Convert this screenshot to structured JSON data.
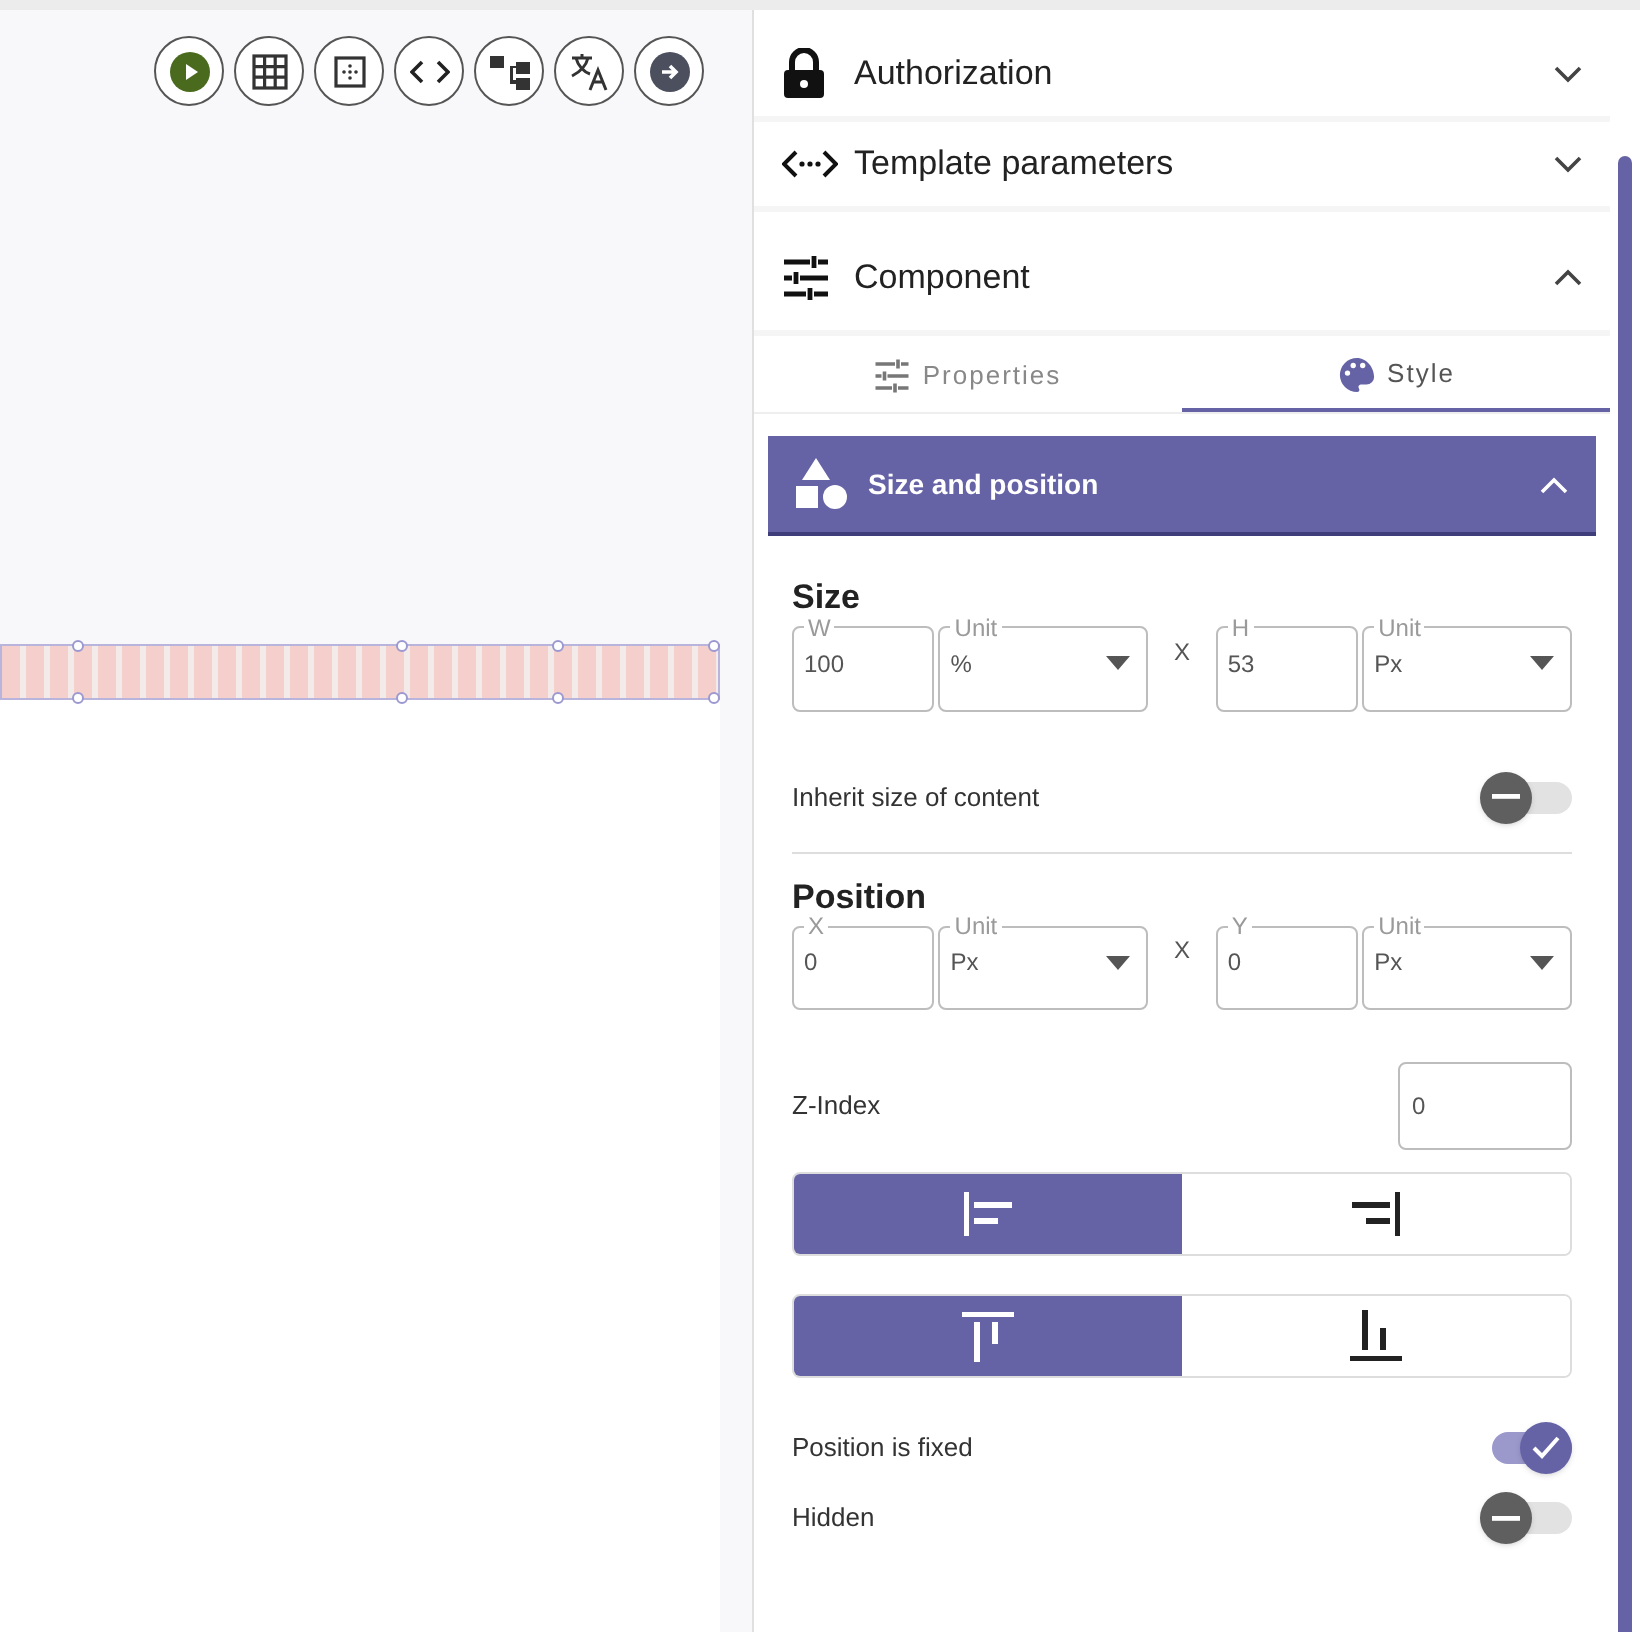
{
  "toolbar": [
    {
      "kind": "play"
    },
    {
      "kind": "grid"
    },
    {
      "kind": "dots"
    },
    {
      "kind": "code"
    },
    {
      "kind": "tree"
    },
    {
      "kind": "translate"
    },
    {
      "kind": "arrow"
    }
  ],
  "sections": [
    {
      "kind": "lock",
      "title": "Authorization",
      "expanded": false
    },
    {
      "kind": "params",
      "title": "Template parameters",
      "expanded": false
    },
    {
      "kind": "sliders",
      "title": "Component",
      "expanded": true
    }
  ],
  "tabs": [
    {
      "kind": "sliders",
      "label": "Properties",
      "selected": false
    },
    {
      "kind": "palette",
      "label": "Style",
      "selected": true
    }
  ],
  "subsection": {
    "title": "Size and position",
    "expanded": true
  },
  "size": {
    "title": "Size",
    "separator": "X",
    "fields": [
      {
        "kind": "input",
        "label": "W",
        "value": "100"
      },
      {
        "kind": "select",
        "label": "Unit",
        "value": "%"
      },
      {
        "kind": "input",
        "label": "H",
        "value": "53"
      },
      {
        "kind": "select",
        "label": "Unit",
        "value": "Px"
      }
    ]
  },
  "inherit": {
    "label": "Inherit size of content",
    "on": false
  },
  "position": {
    "title": "Position",
    "separator": "X",
    "fields": [
      {
        "kind": "input",
        "label": "X",
        "value": "0"
      },
      {
        "kind": "select",
        "label": "Unit",
        "value": "Px"
      },
      {
        "kind": "input",
        "label": "Y",
        "value": "0"
      },
      {
        "kind": "select",
        "label": "Unit",
        "value": "Px"
      }
    ]
  },
  "z_index": {
    "label": "Z-Index",
    "value": "0"
  },
  "horizontal_align": [
    {
      "kind": "left",
      "selected": true
    },
    {
      "kind": "right",
      "selected": false
    }
  ],
  "vertical_align": [
    {
      "kind": "top",
      "selected": true
    },
    {
      "kind": "bottom",
      "selected": false
    }
  ],
  "toggles": [
    {
      "label": "Position is fixed",
      "on": true
    },
    {
      "label": "Hidden",
      "on": false
    }
  ]
}
